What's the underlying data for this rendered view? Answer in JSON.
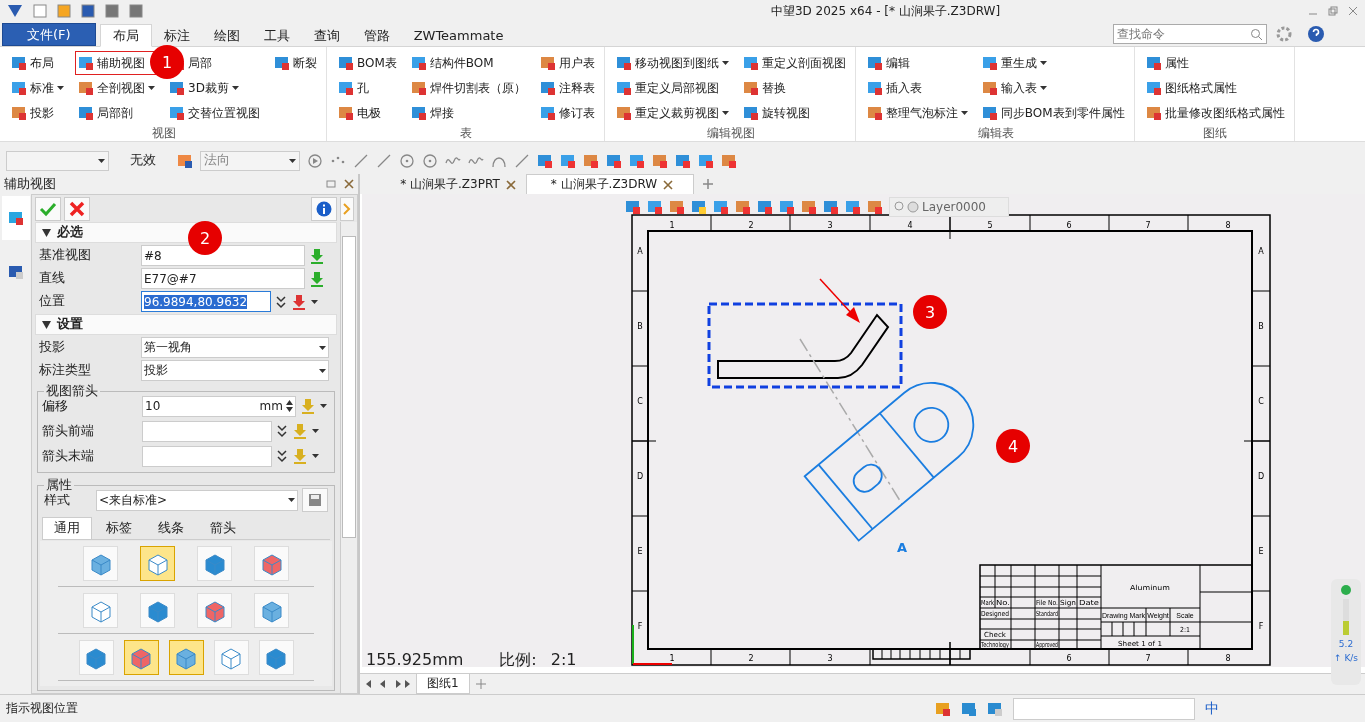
{
  "window": {
    "title": "中望3D 2025 x64 - [* 山涧果子.Z3DRW]"
  },
  "menu_tabs": [
    {
      "label": "文件(F)",
      "kind": "file",
      "selected": false
    },
    {
      "label": "布局",
      "kind": "tab",
      "selected": true
    },
    {
      "label": "标注",
      "kind": "tab",
      "selected": false
    },
    {
      "label": "绘图",
      "kind": "tab",
      "selected": false
    },
    {
      "label": "工具",
      "kind": "tab",
      "selected": false
    },
    {
      "label": "查询",
      "kind": "tab",
      "selected": false
    },
    {
      "label": "管路",
      "kind": "tab",
      "selected": false
    },
    {
      "label": "ZWTeammate",
      "kind": "tab",
      "selected": false
    }
  ],
  "command_search": {
    "placeholder": "查找命令"
  },
  "ribbon_groups": [
    {
      "label": "视图",
      "columns": [
        [
          {
            "label": "布局",
            "has_menu": false,
            "highlighted": false
          },
          {
            "label": "标准",
            "has_menu": true,
            "highlighted": false
          },
          {
            "label": "投影",
            "has_menu": false,
            "highlighted": false
          }
        ],
        [
          {
            "label": "辅助视图",
            "has_menu": false,
            "highlighted": true
          },
          {
            "label": "全剖视图",
            "has_menu": true,
            "highlighted": false
          },
          {
            "label": "局部剖",
            "has_menu": false,
            "highlighted": false
          }
        ],
        [
          {
            "label": "局部",
            "has_menu": false,
            "highlighted": false
          },
          {
            "label": "3D裁剪",
            "has_menu": true,
            "highlighted": false
          },
          {
            "label": "交替位置视图",
            "has_menu": false,
            "highlighted": false
          }
        ],
        [
          {
            "label": "断裂",
            "has_menu": false,
            "highlighted": false
          }
        ]
      ]
    },
    {
      "label": "表",
      "columns": [
        [
          {
            "label": "BOM表",
            "has_menu": false,
            "highlighted": false
          },
          {
            "label": "孔",
            "has_menu": false,
            "highlighted": false
          },
          {
            "label": "电极",
            "has_menu": false,
            "highlighted": false
          }
        ],
        [
          {
            "label": "结构件BOM",
            "has_menu": false,
            "highlighted": false
          },
          {
            "label": "焊件切割表（原）",
            "has_menu": false,
            "highlighted": false
          },
          {
            "label": "焊接",
            "has_menu": false,
            "highlighted": false
          }
        ],
        [
          {
            "label": "用户表",
            "has_menu": false,
            "highlighted": false
          },
          {
            "label": "注释表",
            "has_menu": false,
            "highlighted": false
          },
          {
            "label": "修订表",
            "has_menu": false,
            "highlighted": false
          }
        ]
      ]
    },
    {
      "label": "编辑视图",
      "columns": [
        [
          {
            "label": "移动视图到图纸",
            "has_menu": true,
            "highlighted": false
          },
          {
            "label": "重定义局部视图",
            "has_menu": false,
            "highlighted": false
          },
          {
            "label": "重定义裁剪视图",
            "has_menu": true,
            "highlighted": false
          }
        ],
        [
          {
            "label": "重定义剖面视图",
            "has_menu": false,
            "highlighted": false
          },
          {
            "label": "替换",
            "has_menu": false,
            "highlighted": false
          },
          {
            "label": "旋转视图",
            "has_menu": false,
            "highlighted": false
          }
        ]
      ]
    },
    {
      "label": "编辑表",
      "columns": [
        [
          {
            "label": "编辑",
            "has_menu": false,
            "highlighted": false
          },
          {
            "label": "插入表",
            "has_menu": false,
            "highlighted": false
          },
          {
            "label": "整理气泡标注",
            "has_menu": true,
            "highlighted": false
          }
        ],
        [
          {
            "label": "重生成",
            "has_menu": true,
            "highlighted": false
          },
          {
            "label": "输入表",
            "has_menu": true,
            "highlighted": false
          },
          {
            "label": "同步BOM表到零件属性",
            "has_menu": false,
            "highlighted": false
          }
        ]
      ]
    },
    {
      "label": "图纸",
      "columns": [
        [
          {
            "label": "属性",
            "has_menu": false,
            "highlighted": false
          },
          {
            "label": "图纸格式属性",
            "has_menu": false,
            "highlighted": false
          },
          {
            "label": "批量修改图纸格式属性",
            "has_menu": false,
            "highlighted": false
          }
        ]
      ]
    }
  ],
  "toolbar": {
    "status": "无效",
    "direction": "法向"
  },
  "document_tabs": [
    {
      "label": "* 山涧果子.Z3PRT",
      "selected": false
    },
    {
      "label": "* 山涧果子.Z3DRW",
      "selected": true
    }
  ],
  "view_toolbar": {
    "layer": "Layer0000"
  },
  "panel": {
    "title": "辅助视图",
    "sections": [
      {
        "title": "必选",
        "expanded": true,
        "fields": [
          {
            "label": "基准视图",
            "value": "#8",
            "kind": "pick"
          },
          {
            "label": "直线",
            "value": "E77@#7",
            "kind": "pick"
          },
          {
            "label": "位置",
            "value": "96.9894,80.9632",
            "kind": "point",
            "text_selected": true
          }
        ]
      },
      {
        "title": "设置",
        "expanded": true,
        "fields": [
          {
            "label": "投影",
            "value": "第一视角",
            "kind": "dropdown"
          },
          {
            "label": "标注类型",
            "value": "投影",
            "kind": "dropdown"
          }
        ],
        "groups": [
          {
            "title": "视图箭头",
            "fields": [
              {
                "label": "偏移",
                "value": "10",
                "unit": "mm",
                "kind": "spin"
              },
              {
                "label": "箭头前端",
                "kind": "arrow"
              },
              {
                "label": "箭头末端",
                "kind": "arrow"
              }
            ]
          },
          {
            "title": "属性",
            "fields": [
              {
                "label": "样式",
                "value": "<来自标准>",
                "kind": "style"
              }
            ],
            "tabs": [
              {
                "label": "通用",
                "selected": true
              },
              {
                "label": "标签",
                "selected": false
              },
              {
                "label": "线条",
                "selected": false
              },
              {
                "label": "箭头",
                "selected": false
              }
            ],
            "icon_rows": [
              [
                {
                  "selected": false
                },
                {
                  "selected": true
                },
                {
                  "selected": false
                },
                {
                  "selected": false
                }
              ],
              [
                {
                  "selected": false
                },
                {
                  "selected": false
                },
                {
                  "selected": false
                },
                {
                  "selected": false
                }
              ],
              [
                {
                  "selected": false
                },
                {
                  "selected": true
                },
                {
                  "selected": true
                },
                {
                  "selected": false
                },
                {
                  "selected": false
                }
              ]
            ]
          }
        ]
      }
    ]
  },
  "drawing": {
    "top_column_labels": [
      "1",
      "2",
      "3",
      "4",
      "5",
      "6",
      "7",
      "8"
    ],
    "bottom_column_labels": [
      "1",
      "2",
      "3",
      "6",
      "7",
      "8"
    ],
    "left_row_labels": [
      "A",
      "B",
      "C",
      "D",
      "E",
      "F"
    ],
    "right_row_labels": [
      "A",
      "B",
      "C",
      "D",
      "E",
      "F"
    ],
    "view_label": "A",
    "title_block": {
      "material": "Aluminum",
      "headers": [
        "Mark",
        "No.",
        "File No.",
        "Sign",
        "Date"
      ],
      "designed": "Designed",
      "standard": "Standard",
      "check": "Check",
      "process": "Technology",
      "approved": "Approved",
      "drawing_mark": "Drawing Mark",
      "weight": "Weight",
      "scale_label": "Scale",
      "scale": "2:1",
      "sheet": "Sheet  1  of  1"
    }
  },
  "readout": {
    "length": "155.925mm",
    "scale_label": "比例:",
    "scale": "2:1"
  },
  "sheet_tabs": [
    {
      "label": "图纸1",
      "selected": true
    }
  ],
  "callouts": [
    "1",
    "2",
    "3",
    "4"
  ],
  "network_meter": {
    "rate": "5.2",
    "unit": "↑ K/s"
  },
  "status_bar": {
    "message": "指示视图位置",
    "ime": "中"
  }
}
